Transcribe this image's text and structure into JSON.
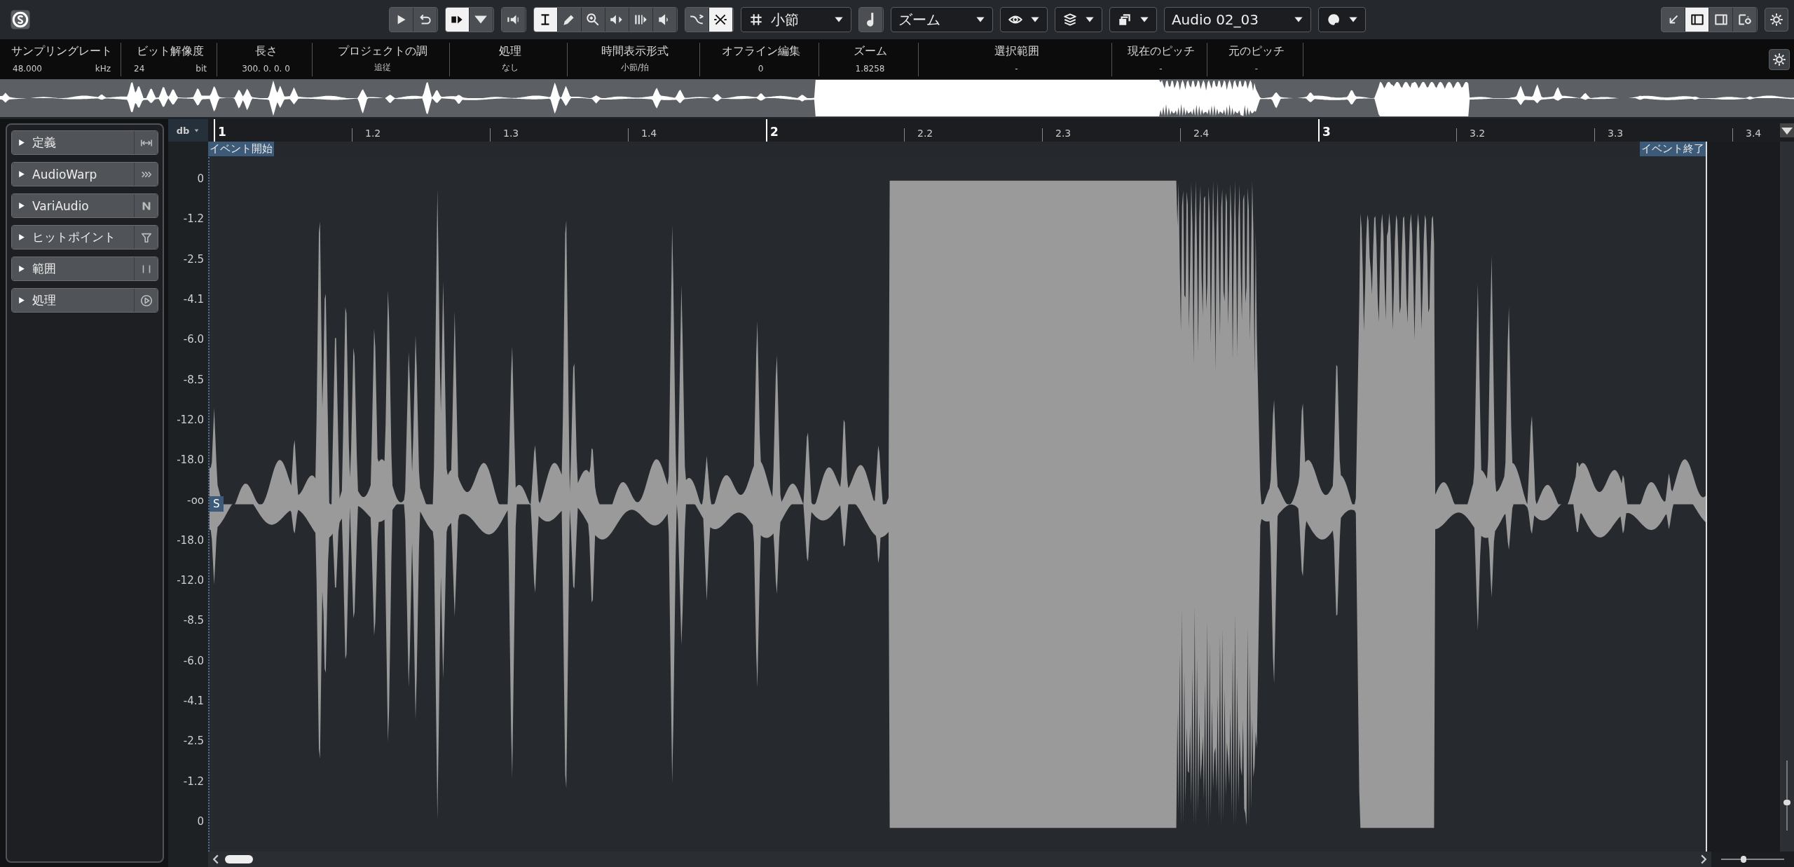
{
  "toolbar": [
    {
      "kind": "segment",
      "buttons": [
        {
          "selected": false
        },
        {
          "selected": false
        }
      ]
    },
    {
      "kind": "segment",
      "buttons": [
        {
          "selected": true
        },
        {
          "selected": false
        }
      ]
    },
    {
      "kind": "segment",
      "buttons": [
        {
          "selected": false
        }
      ]
    },
    {
      "kind": "segment",
      "buttons": [
        {
          "selected": true
        },
        {
          "selected": false
        },
        {
          "selected": false
        },
        {
          "selected": false
        },
        {
          "selected": false
        },
        {
          "selected": false
        }
      ]
    },
    {
      "kind": "segment",
      "buttons": [
        {
          "selected": false
        },
        {
          "selected": true
        }
      ]
    },
    {
      "kind": "dropdown",
      "value": "小節"
    },
    {
      "kind": "segment",
      "buttons": [
        {
          "selected": false
        }
      ]
    },
    {
      "kind": "dropdown",
      "value": "ズーム"
    },
    {
      "kind": "dropdown"
    },
    {
      "kind": "dropdown"
    },
    {
      "kind": "dropdown"
    },
    {
      "kind": "dropdown",
      "value": "Audio 02_03"
    },
    {
      "kind": "dropdown"
    }
  ],
  "window_zones": [
    {
      "selected": false
    },
    {
      "selected": true
    },
    {
      "selected": false
    },
    {
      "selected": false
    }
  ],
  "info_line": [
    {
      "label": "サンプリングレート",
      "value": "48.000",
      "unit": "kHz"
    },
    {
      "label": "ビット解像度",
      "value": "24",
      "unit": "bit"
    },
    {
      "label": "長さ",
      "value": "300. 0. 0. 0"
    },
    {
      "label": "プロジェクトの調",
      "value": "追従"
    },
    {
      "label": "処理",
      "value": "なし"
    },
    {
      "label": "時間表示形式",
      "value": "小節/拍"
    },
    {
      "label": "オフライン編集",
      "value": "0"
    },
    {
      "label": "ズーム",
      "value": "1.8258"
    },
    {
      "label": "選択範囲",
      "value": "-"
    },
    {
      "label": "現在のピッチ",
      "value": "-"
    },
    {
      "label": "元のピッチ",
      "value": "-"
    }
  ],
  "inspector": [
    {
      "label": "定義",
      "expanded": false
    },
    {
      "label": "AudioWarp",
      "expanded": false
    },
    {
      "label": "VariAudio",
      "expanded": false
    },
    {
      "label": "ヒットポイント",
      "expanded": false
    },
    {
      "label": "範囲",
      "expanded": false
    },
    {
      "label": "処理",
      "expanded": false
    }
  ],
  "scale_unit": "db",
  "ruler": [
    {
      "label": "1",
      "major": true
    },
    {
      "label": "1.2",
      "major": false
    },
    {
      "label": "1.3",
      "major": false
    },
    {
      "label": "1.4",
      "major": false
    },
    {
      "label": "2",
      "major": true
    },
    {
      "label": "2.2",
      "major": false
    },
    {
      "label": "2.3",
      "major": false
    },
    {
      "label": "2.4",
      "major": false
    },
    {
      "label": "3",
      "major": true
    },
    {
      "label": "3.2",
      "major": false
    },
    {
      "label": "3.3",
      "major": false
    },
    {
      "label": "3.4",
      "major": false
    }
  ],
  "event_start": "イベント開始",
  "event_end": "イベント終了",
  "db_scale": [
    "0",
    "-1.2",
    "-2.5",
    "-4.1",
    "-6.0",
    "-8.5",
    "-12.0",
    "-18.0",
    "-oo",
    "-18.0",
    "-12.0",
    "-8.5",
    "-6.0",
    "-4.1",
    "-2.5",
    "-1.2",
    "0"
  ],
  "sync_marker": "S",
  "vertical_zoom": {
    "level": 0.4
  },
  "horizontal_zoom": {
    "level": 0.35
  }
}
